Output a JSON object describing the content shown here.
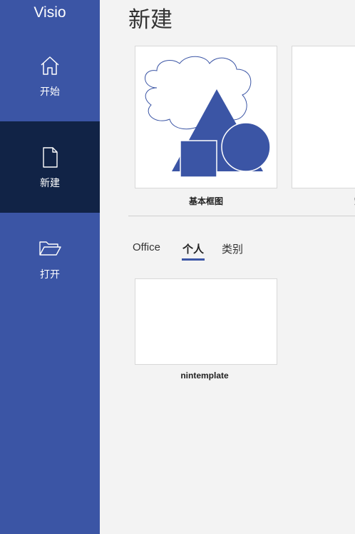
{
  "app": {
    "title": "Visio"
  },
  "sidebar": {
    "items": [
      {
        "label": "开始",
        "icon": "home-icon"
      },
      {
        "label": "新建",
        "icon": "new-document-icon",
        "active": true
      },
      {
        "label": "打开",
        "icon": "open-folder-icon"
      }
    ]
  },
  "main": {
    "title": "新建",
    "featured_templates": [
      {
        "label": "基本框图"
      },
      {
        "label": "空白"
      }
    ],
    "tabs": [
      {
        "label": "Office"
      },
      {
        "label": "个人",
        "active": true
      },
      {
        "label": "类别"
      }
    ],
    "personal_templates": [
      {
        "label": "nintemplate"
      }
    ]
  },
  "colors": {
    "sidebar_bg": "#3b55a5",
    "sidebar_active_bg": "#112346",
    "content_bg": "#f3f3f3",
    "accent": "#3b55a5"
  }
}
